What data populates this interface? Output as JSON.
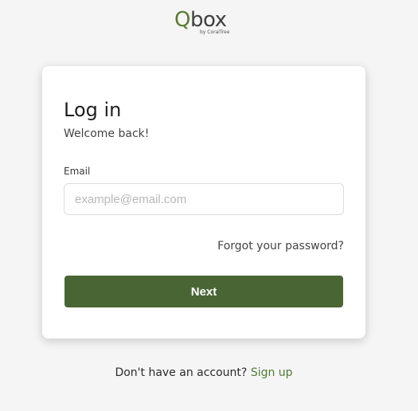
{
  "brand": {
    "logo_q": "Q",
    "logo_rest": "box",
    "logo_sub": "by CoralTree",
    "accent_color": "#4a6534"
  },
  "login": {
    "title": "Log in",
    "subtitle": "Welcome back!",
    "email_label": "Email",
    "email_placeholder": "example@email.com",
    "email_value": "",
    "forgot_link": "Forgot your password?",
    "next_button": "Next"
  },
  "footer": {
    "prompt": "Don't have an account?",
    "signup_link": "Sign up"
  }
}
